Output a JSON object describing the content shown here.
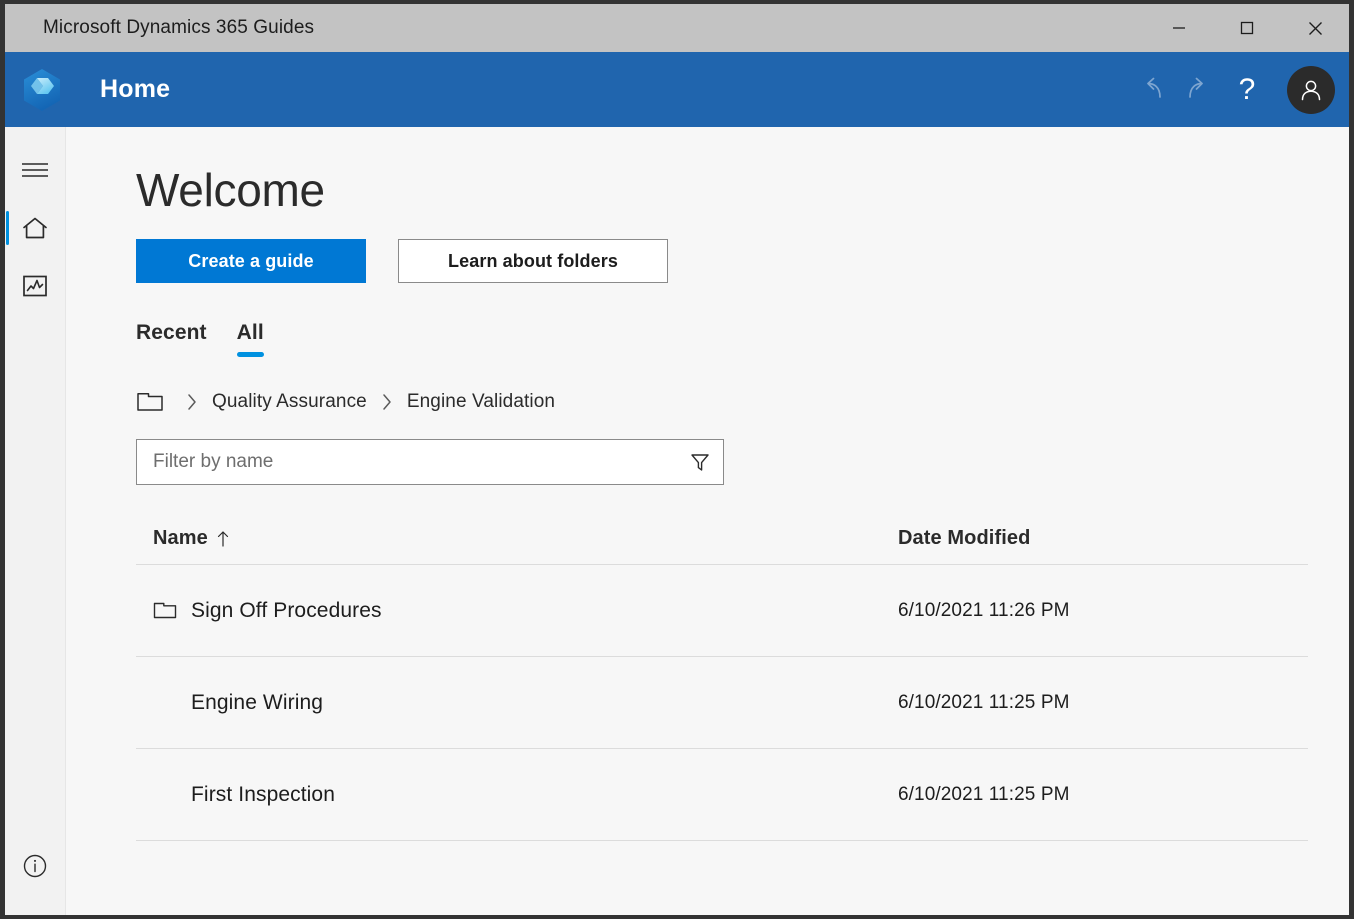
{
  "window": {
    "title": "Microsoft Dynamics 365 Guides",
    "controls": {
      "minimize": "minimize-icon",
      "maximize": "maximize-icon",
      "close": "close-icon"
    }
  },
  "appbar": {
    "logo": "dynamics-365-guides-logo",
    "title": "Home",
    "undo": "undo-icon",
    "redo": "redo-icon",
    "help": "?",
    "avatar": "person-icon",
    "background_color": "#2065ae"
  },
  "rail": {
    "items": [
      {
        "name": "menu",
        "icon": "hamburger-menu-icon",
        "active": false
      },
      {
        "name": "home",
        "icon": "home-icon",
        "active": true
      },
      {
        "name": "analytics",
        "icon": "analytics-chart-icon",
        "active": false
      }
    ],
    "bottom": {
      "name": "info",
      "icon": "info-circle-icon"
    },
    "accent_color": "#0091e0"
  },
  "main": {
    "heading": "Welcome",
    "buttons": {
      "primary": "Create a guide",
      "secondary": "Learn about folders"
    },
    "primary_button_color": "#0078d4",
    "tabs": [
      {
        "label": "Recent",
        "active": false
      },
      {
        "label": "All",
        "active": true
      }
    ],
    "breadcrumb": {
      "root_icon": "folder-icon",
      "separator": "chevron-right-icon",
      "items": [
        "Quality Assurance",
        "Engine Validation"
      ]
    },
    "filter": {
      "placeholder": "Filter by name",
      "value": "",
      "icon": "filter-funnel-icon"
    },
    "table": {
      "columns": [
        {
          "label": "Name",
          "sort": "ascending",
          "sort_icon": "arrow-up-icon"
        },
        {
          "label": "Date Modified",
          "sort": "none"
        }
      ],
      "rows": [
        {
          "name": "Sign Off Procedures",
          "date_modified": "6/10/2021 11:26 PM",
          "icon": "folder-icon",
          "is_folder": true
        },
        {
          "name": "Engine Wiring",
          "date_modified": "6/10/2021 11:25 PM",
          "icon": "",
          "is_folder": false
        },
        {
          "name": "First Inspection",
          "date_modified": "6/10/2021 11:25 PM",
          "icon": "",
          "is_folder": false
        }
      ]
    }
  }
}
